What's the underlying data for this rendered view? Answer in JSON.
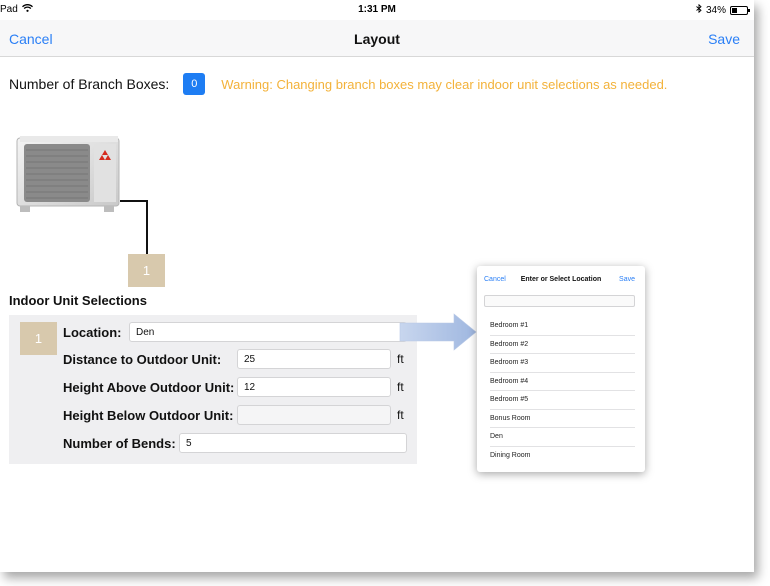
{
  "status_bar": {
    "carrier": "Pad",
    "time": "1:31 PM",
    "battery": "34%"
  },
  "nav": {
    "cancel_label": "Cancel",
    "title": "Layout",
    "save_label": "Save"
  },
  "branch": {
    "label": "Number of Branch Boxes:",
    "count": "0",
    "warning": "Warning: Changing branch boxes may clear indoor unit selections as needed."
  },
  "diagram": {
    "unit_number": "1"
  },
  "indoor": {
    "section_title": "Indoor Unit Selections",
    "unit_number": "1",
    "location_label": "Location:",
    "location_value": "Den",
    "distance_label": "Distance to Outdoor Unit:",
    "distance_value": "25",
    "height_above_label": "Height Above Outdoor Unit:",
    "height_above_value": "12",
    "height_below_label": "Height Below Outdoor Unit:",
    "height_below_value": "",
    "bends_label": "Number of Bends:",
    "bends_value": "5",
    "unit_ft": "ft"
  },
  "popover": {
    "cancel_label": "Cancel",
    "title": "Enter or Select Location",
    "save_label": "Save",
    "search_placeholder": "",
    "locations": [
      "Bedroom #1",
      "Bedroom #2",
      "Bedroom #3",
      "Bedroom #4",
      "Bedroom #5",
      "Bonus Room",
      "Den",
      "Dining Room"
    ]
  },
  "colors": {
    "accent": "#2a7ff6",
    "warning": "#f3b23a",
    "unit_box": "#d8c9ad",
    "branch_badge": "#1e7df3",
    "arrow": "#a9bfe3"
  }
}
